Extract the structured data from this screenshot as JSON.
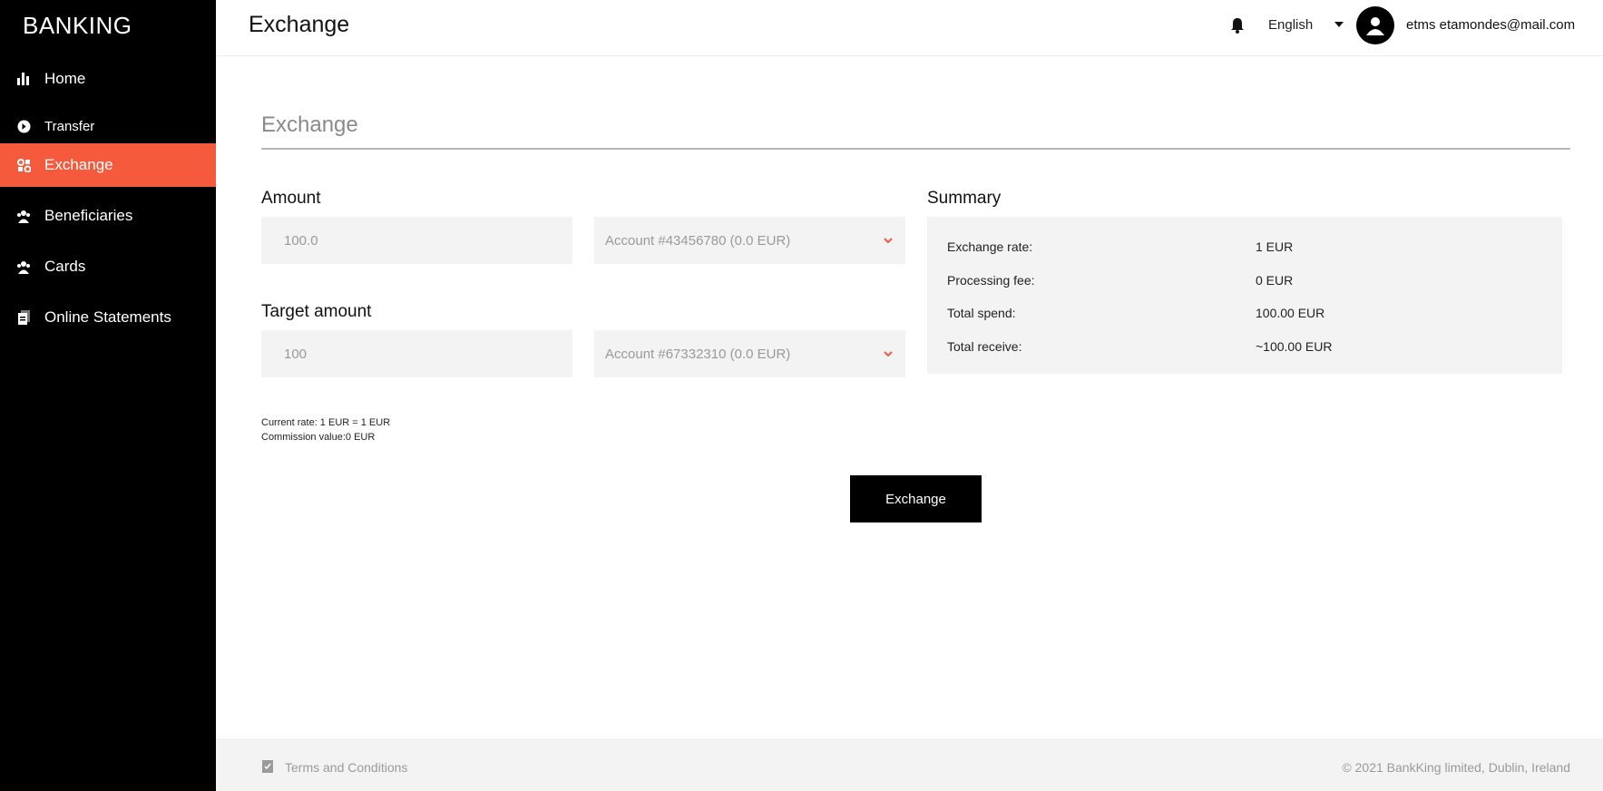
{
  "brand": {
    "logo_text": "BANKING",
    "accent": "#f55a3c"
  },
  "sidebar": {
    "items": [
      {
        "label": "Home",
        "icon": "bar-chart-icon"
      },
      {
        "label": "Transfer",
        "icon": "arrow-circle-icon"
      },
      {
        "label": "Exchange",
        "icon": "exchange-icon",
        "active": true
      },
      {
        "label": "Beneficiaries",
        "icon": "people-icon"
      },
      {
        "label": "Cards",
        "icon": "people-icon"
      },
      {
        "label": "Online Statements",
        "icon": "document-icon"
      }
    ]
  },
  "header": {
    "title": "Exchange",
    "language": "English",
    "user_email": "etms etamondes@mail.com"
  },
  "main": {
    "section_title": "Exchange",
    "amount": {
      "label": "Amount",
      "value": "100.0",
      "account": "Account #43456780 (0.0 EUR)"
    },
    "target": {
      "label": "Target amount",
      "value": "100",
      "account": "Account #67332310 (0.0 EUR)"
    },
    "current_rate": "Current rate: 1 EUR = 1 EUR",
    "commission": "Commission value:0 EUR",
    "button_label": "Exchange"
  },
  "summary": {
    "title": "Summary",
    "rows": [
      {
        "label": "Exchange rate:",
        "value": "1 EUR"
      },
      {
        "label": "Processing fee:",
        "value": "0 EUR"
      },
      {
        "label": "Total spend:",
        "value": "100.00 EUR"
      },
      {
        "label": "Total receive:",
        "value": "~100.00 EUR"
      }
    ]
  },
  "footer": {
    "terms": "Terms and Conditions",
    "copyright": "© 2021 BankKing limited, Dublin, Ireland"
  }
}
